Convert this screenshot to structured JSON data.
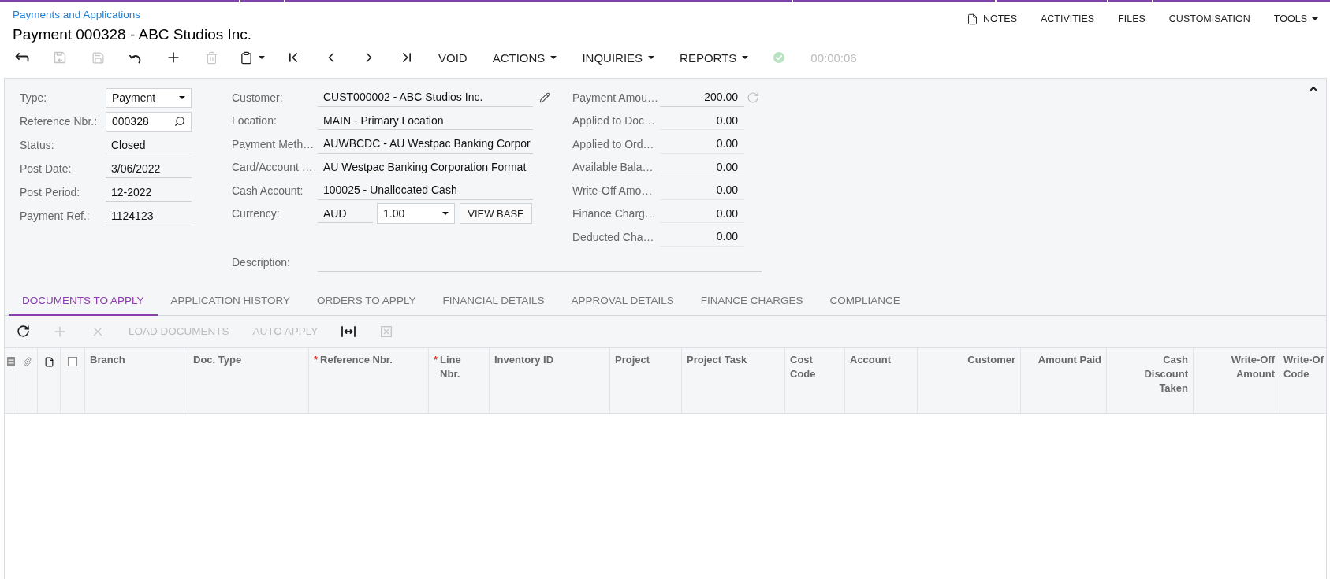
{
  "breadcrumb": "Payments and Applications",
  "title": "Payment 000328 - ABC Studios Inc.",
  "header_actions": [
    {
      "kind": "notes",
      "label": "NOTES"
    },
    {
      "kind": "plain",
      "label": "ACTIVITIES"
    },
    {
      "kind": "plain",
      "label": "FILES"
    },
    {
      "kind": "plain",
      "label": "CUSTOMISATION"
    },
    {
      "kind": "menu",
      "label": "TOOLS"
    }
  ],
  "toolbar": [
    {
      "kind": "back",
      "disabled": false,
      "menu": false
    },
    {
      "kind": "saveclose",
      "disabled": true,
      "menu": false
    },
    {
      "kind": "save",
      "disabled": true,
      "menu": false
    },
    {
      "kind": "undo",
      "disabled": false,
      "menu": false
    },
    {
      "kind": "add",
      "disabled": false,
      "menu": false
    },
    {
      "kind": "delete",
      "disabled": true,
      "menu": false
    },
    {
      "kind": "clipboard",
      "disabled": false,
      "menu": true
    },
    {
      "kind": "first",
      "disabled": false,
      "menu": false
    },
    {
      "kind": "previous",
      "disabled": false,
      "menu": false
    },
    {
      "kind": "next",
      "disabled": false,
      "menu": false
    },
    {
      "kind": "last",
      "disabled": false,
      "menu": false
    },
    {
      "kind": "action",
      "label": "VOID",
      "disabled": false,
      "menu": false
    },
    {
      "kind": "action",
      "label": "ACTIONS",
      "disabled": false,
      "menu": true
    },
    {
      "kind": "action",
      "label": "INQUIRIES",
      "disabled": false,
      "menu": true
    },
    {
      "kind": "action",
      "label": "REPORTS",
      "disabled": false,
      "menu": true
    }
  ],
  "timer": "00:00:06",
  "summary": {
    "expanded": true,
    "column_1": [
      {
        "label": "Type:",
        "kind": "select",
        "value": "Payment"
      },
      {
        "label": "Reference Nbr.:",
        "kind": "search",
        "value": "000328"
      },
      {
        "label": "Status:",
        "kind": "static",
        "value": "Closed"
      },
      {
        "label": "Post Date:",
        "kind": "text",
        "value": "3/06/2022"
      },
      {
        "label": "Post Period:",
        "kind": "text",
        "value": "12-2022"
      },
      {
        "label": "Payment Ref.:",
        "kind": "text",
        "value": "1124123"
      }
    ],
    "column_2": [
      {
        "label": "Customer:",
        "kind": "text",
        "value": "CUST000002 - ABC Studios Inc.",
        "addon": {
          "kind": "edit",
          "disabled": false
        }
      },
      {
        "label": "Location:",
        "kind": "text",
        "value": "MAIN - Primary Location"
      },
      {
        "label": "Payment Meth…",
        "kind": "text",
        "value": "AUWBCDC - AU Westpac Banking Corpor"
      },
      {
        "label": "Card/Account …",
        "kind": "text",
        "value": "AU Westpac Banking Corporation Format"
      },
      {
        "label": "Cash Account:",
        "kind": "text",
        "value": "100025 - Unallocated Cash"
      },
      {
        "label": "Currency:",
        "kind": "currency",
        "value": "AUD",
        "rate": "1.00",
        "button": "VIEW BASE"
      }
    ],
    "column_3": [
      {
        "label": "Payment Amou…",
        "kind": "text",
        "value": "200.00",
        "addon": {
          "kind": "refresh",
          "disabled": true
        }
      },
      {
        "label": "Applied to Doc…",
        "kind": "static",
        "value": "0.00"
      },
      {
        "label": "Applied to Ord…",
        "kind": "static",
        "value": "0.00"
      },
      {
        "label": "Available Bala…",
        "kind": "static",
        "value": "0.00"
      },
      {
        "label": "Write-Off Amo…",
        "kind": "static",
        "value": "0.00"
      },
      {
        "label": "Finance Charg…",
        "kind": "static",
        "value": "0.00"
      },
      {
        "label": "Deducted Cha…",
        "kind": "static",
        "value": "0.00"
      }
    ],
    "description": {
      "label": "Description:",
      "kind": "text"
    }
  },
  "tabs": [
    {
      "label": "DOCUMENTS TO APPLY",
      "selected": true
    },
    {
      "label": "APPLICATION HISTORY",
      "selected": false
    },
    {
      "label": "ORDERS TO APPLY",
      "selected": false
    },
    {
      "label": "FINANCIAL DETAILS",
      "selected": false
    },
    {
      "label": "APPROVAL DETAILS",
      "selected": false
    },
    {
      "label": "FINANCE CHARGES",
      "selected": false
    },
    {
      "label": "COMPLIANCE",
      "selected": false
    }
  ],
  "grid_toolbar": [
    {
      "kind": "refresh",
      "disabled": false
    },
    {
      "kind": "add",
      "disabled": true
    },
    {
      "kind": "remove",
      "disabled": true
    },
    {
      "kind": "action",
      "label": "LOAD DOCUMENTS",
      "disabled": true
    },
    {
      "kind": "action",
      "label": "AUTO APPLY",
      "disabled": true
    },
    {
      "kind": "fit",
      "disabled": false
    },
    {
      "kind": "export",
      "disabled": true
    }
  ],
  "grid": {
    "select_all": {
      "checked": false
    },
    "columns": [
      {
        "label": "Branch"
      },
      {
        "label": "Doc. Type"
      },
      {
        "label": "Reference Nbr.",
        "mark": "*"
      },
      {
        "label": "Line Nbr.",
        "mark": "*"
      },
      {
        "label": "Inventory ID"
      },
      {
        "label": "Project"
      },
      {
        "label": "Project Task"
      },
      {
        "label": "Cost Code"
      },
      {
        "label": "Account"
      },
      {
        "label": "Customer"
      },
      {
        "label": "Amount Paid"
      },
      {
        "label": "Cash Discount Taken"
      },
      {
        "label": "Write-Off Amount"
      },
      {
        "label": "Write-Of Code"
      }
    ]
  }
}
